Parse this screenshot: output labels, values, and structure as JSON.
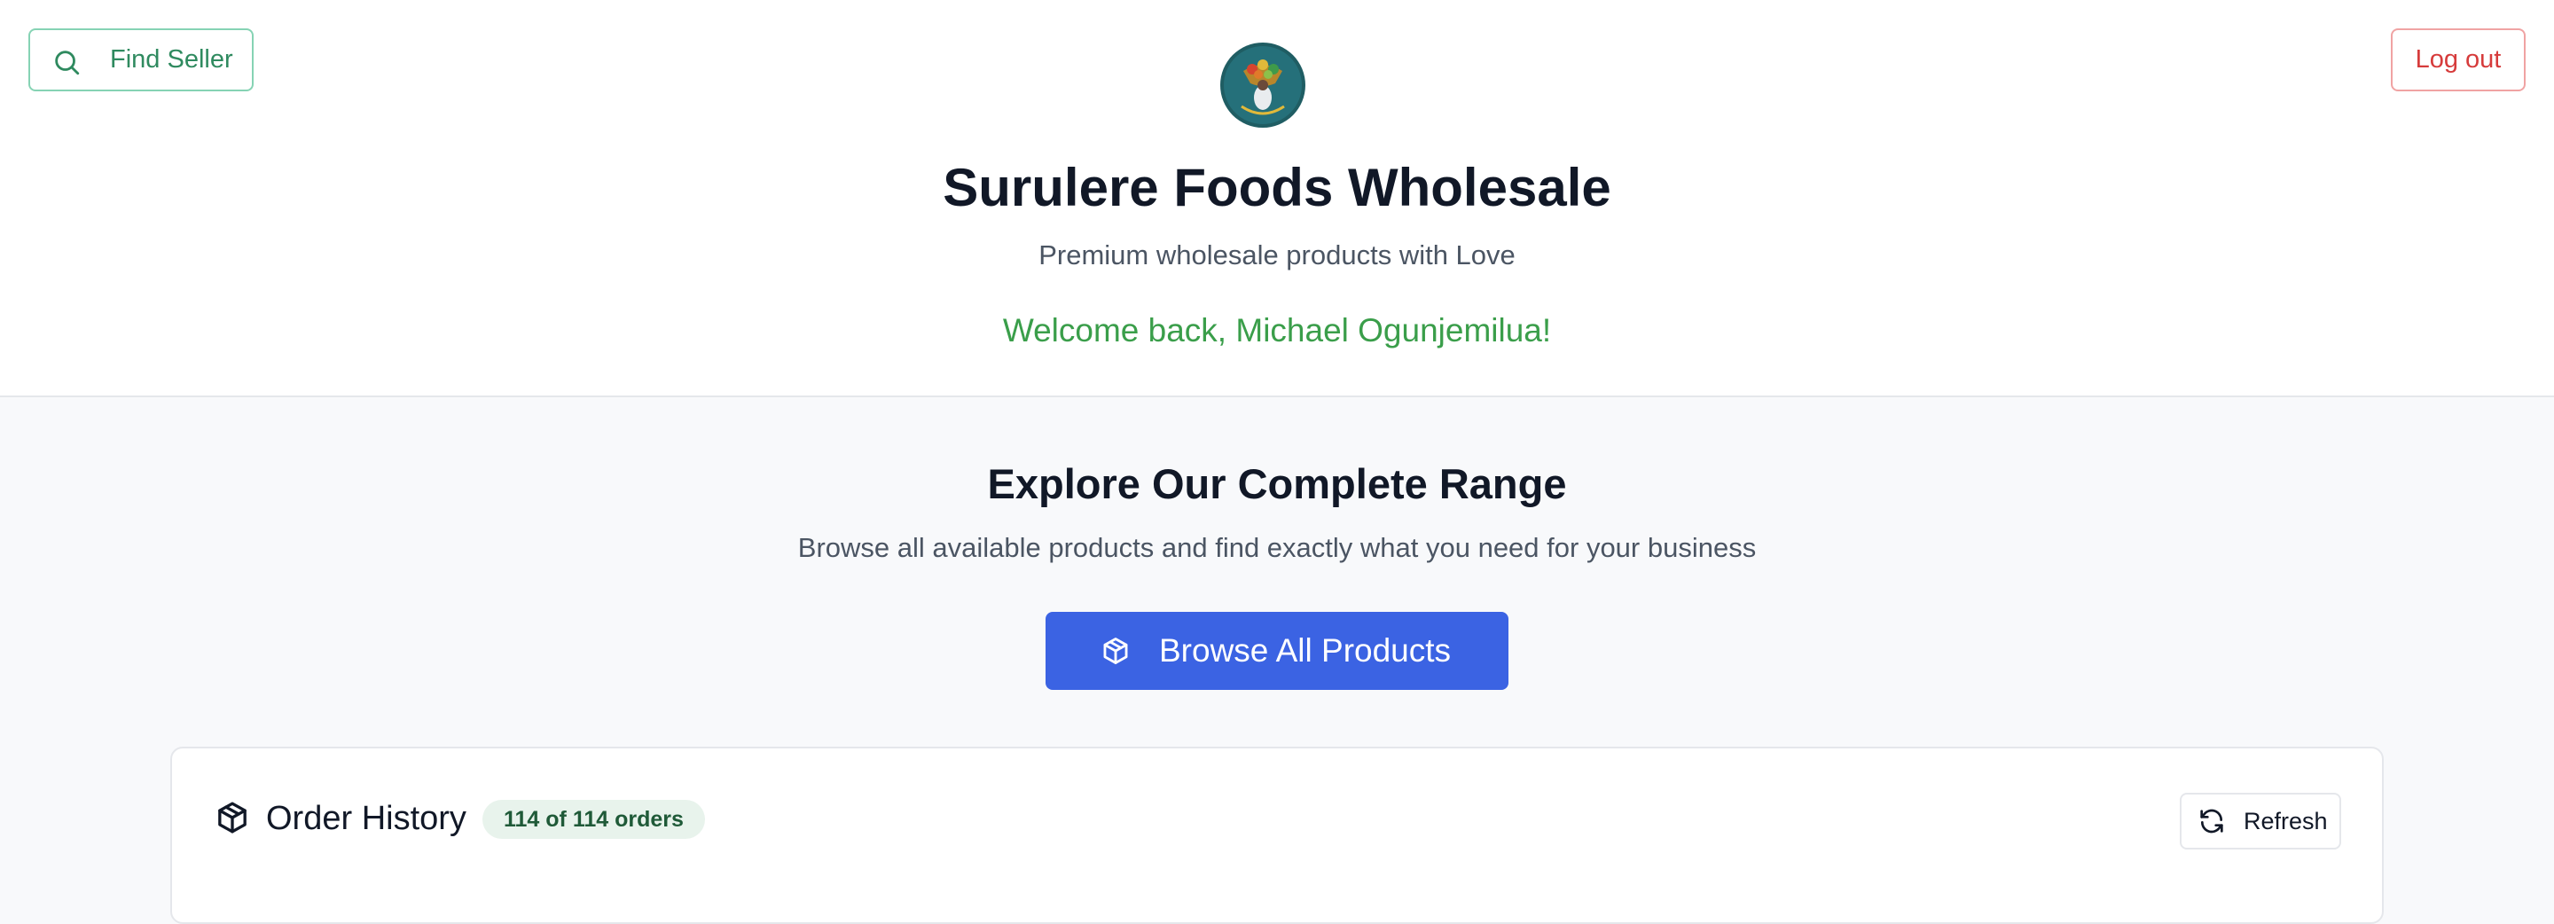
{
  "header": {
    "find_seller_label": "Find Seller",
    "logout_label": "Log out",
    "site_title": "Surulere Foods Wholesale",
    "tagline": "Premium wholesale products with Love",
    "welcome": "Welcome back, Michael Ogunjemilua!",
    "logo_icon": "store-logo"
  },
  "explore": {
    "title": "Explore Our Complete Range",
    "subtitle": "Browse all available products and find exactly what you need for your business",
    "browse_label": "Browse All Products",
    "browse_icon": "package-icon"
  },
  "orders": {
    "title": "Order History",
    "count_badge": "114 of 114 orders",
    "refresh_label": "Refresh",
    "title_icon": "package-icon",
    "refresh_icon": "refresh-icon"
  },
  "colors": {
    "primary": "#3b63e3",
    "success": "#3a9e4a",
    "danger": "#d63b3b",
    "seller_accent": "#2f8a5f",
    "page_bg": "#f8f9fb"
  }
}
